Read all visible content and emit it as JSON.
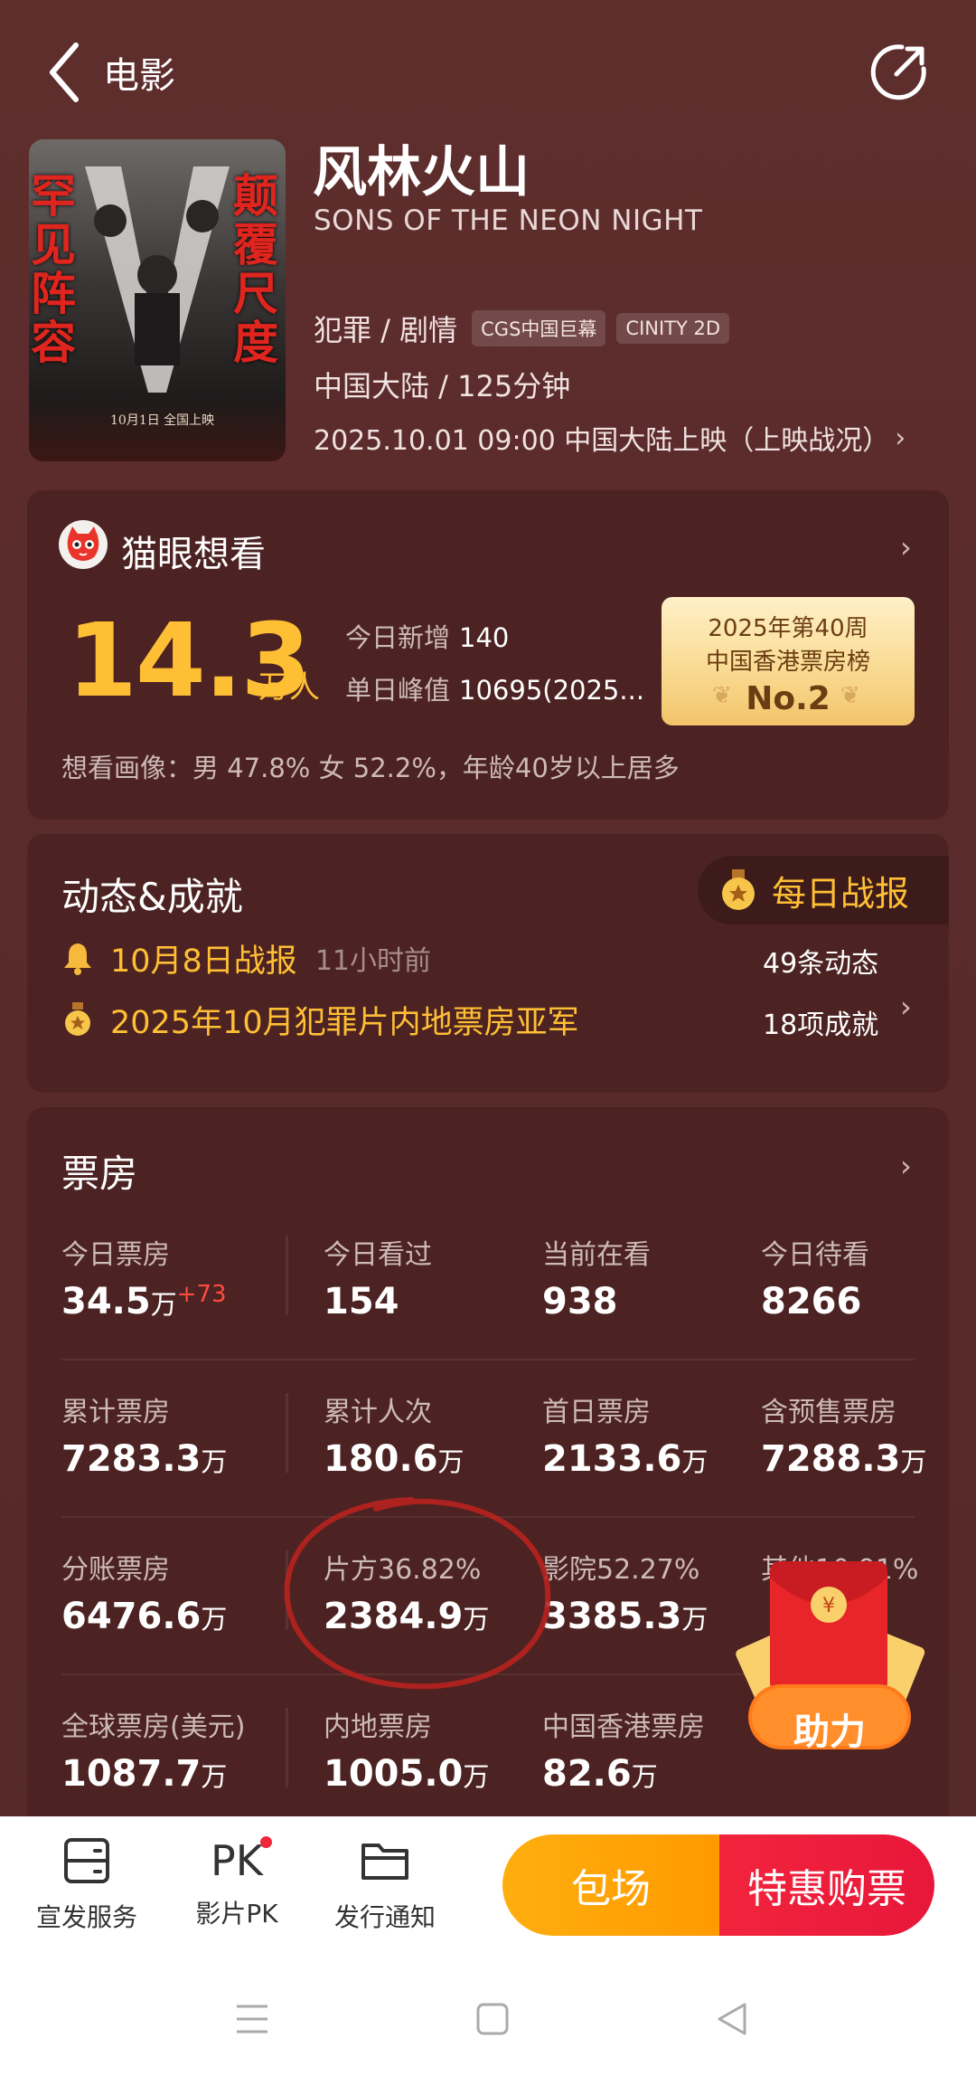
{
  "header": {
    "back_label": "电影"
  },
  "poster": {
    "left_text": "罕见阵容",
    "right_text": "颠覆尺度",
    "tagline": "10月1日 全国上映"
  },
  "movie": {
    "title": "风林火山",
    "title_en": "SONS OF THE NEON NIGHT",
    "genre": "犯罪 / 剧情",
    "tags": [
      "CGS中国巨幕",
      "CINITY 2D"
    ],
    "region_duration": "中国大陆 / 125分钟",
    "release": "2025.10.01 09:00 中国大陆上映（上映战况）"
  },
  "want": {
    "title": "猫眼想看",
    "count": "14.3",
    "unit": "万人",
    "today_new_label": "今日新增",
    "today_new_value": "140",
    "peak_label": "单日峰值",
    "peak_value": "10695(2025...",
    "rank_line1": "2025年第40周",
    "rank_line2": "中国香港票房榜",
    "rank_no": "No.2",
    "portrait": "想看画像：男 47.8%  女 52.2%，年龄40岁以上居多"
  },
  "dynamics": {
    "title": "动态&成就",
    "daily_button": "每日战报",
    "news_title": "10月8日战报",
    "news_time": "11小时前",
    "achievement": "2025年10月犯罪片内地票房亚军",
    "dynamic_count": "49条动态",
    "achievement_count": "18项成就"
  },
  "boxoffice": {
    "title": "票房",
    "r1": [
      {
        "label": "今日票房",
        "value": "34.5",
        "unit": "万",
        "delta": "+73"
      },
      {
        "label": "今日看过",
        "value": "154"
      },
      {
        "label": "当前在看",
        "value": "938"
      },
      {
        "label": "今日待看",
        "value": "8266"
      }
    ],
    "r2": [
      {
        "label": "累计票房",
        "value": "7283.3",
        "unit": "万"
      },
      {
        "label": "累计人次",
        "value": "180.6",
        "unit": "万"
      },
      {
        "label": "首日票房",
        "value": "2133.6",
        "unit": "万"
      },
      {
        "label": "含预售票房",
        "value": "7288.3",
        "unit": "万"
      }
    ],
    "r3": [
      {
        "label": "分账票房",
        "value": "6476.6",
        "unit": "万"
      },
      {
        "label": "片方36.82%",
        "value": "2384.9",
        "unit": "万"
      },
      {
        "label": "影院52.27%",
        "value": "3385.3",
        "unit": "万"
      },
      {
        "label": "其他10.91%"
      }
    ],
    "r4": [
      {
        "label": "全球票房(美元)",
        "value": "1087.7",
        "unit": "万"
      },
      {
        "label": "内地票房",
        "value": "1005.0",
        "unit": "万"
      },
      {
        "label": "中国香港票房",
        "value": "82.6",
        "unit": "万"
      }
    ],
    "red_packet_label": "助力"
  },
  "bottom": {
    "services": "宣发服务",
    "pk": "PK",
    "pk_label": "影片PK",
    "notice": "发行通知",
    "book": "包场",
    "buy": "特惠购票"
  },
  "colors": {
    "accent": "#ffbf35",
    "buy": "#ea1b3b",
    "book": "#ffa10a",
    "card": "#4c2322"
  }
}
